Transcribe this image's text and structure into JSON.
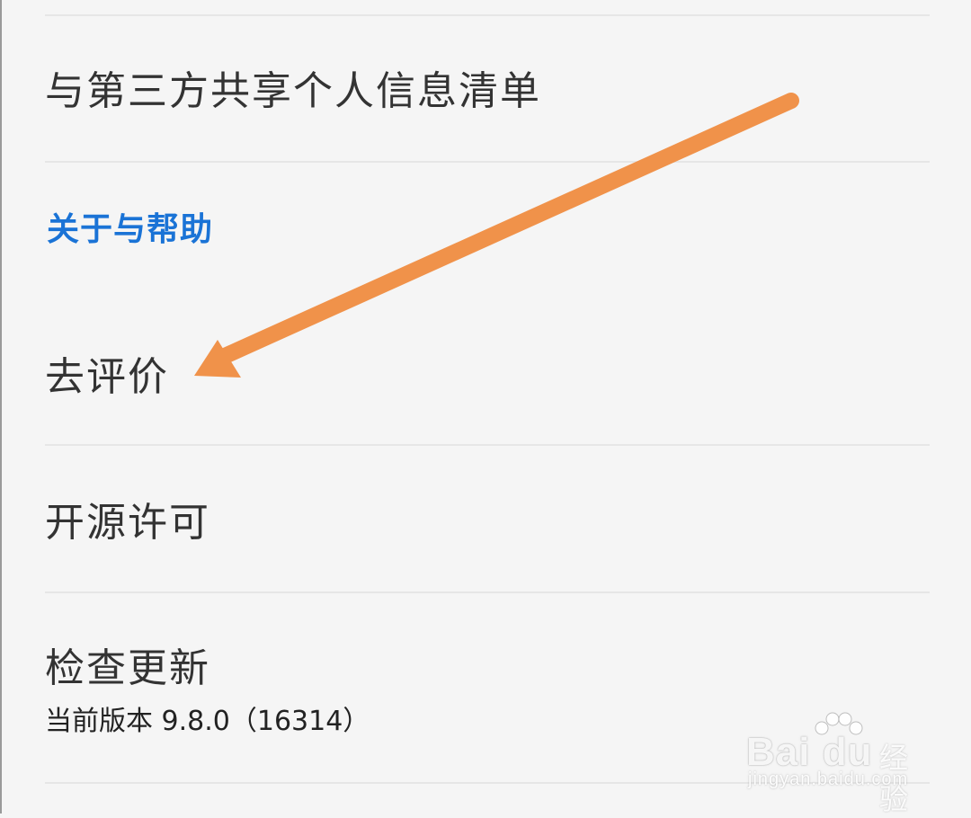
{
  "settings": {
    "items": [
      {
        "label": "与第三方共享个人信息清单"
      },
      {
        "label": "去评价"
      },
      {
        "label": "开源许可"
      },
      {
        "label": "检查更新",
        "sub": "当前版本 9.8.0（16314）"
      }
    ],
    "section_title": "关于与帮助"
  },
  "annotation": {
    "arrow_color": "#f0924a"
  },
  "watermark": {
    "brand": "Bai du",
    "suffix": "经验",
    "url": "jingyan.baidu.com"
  }
}
